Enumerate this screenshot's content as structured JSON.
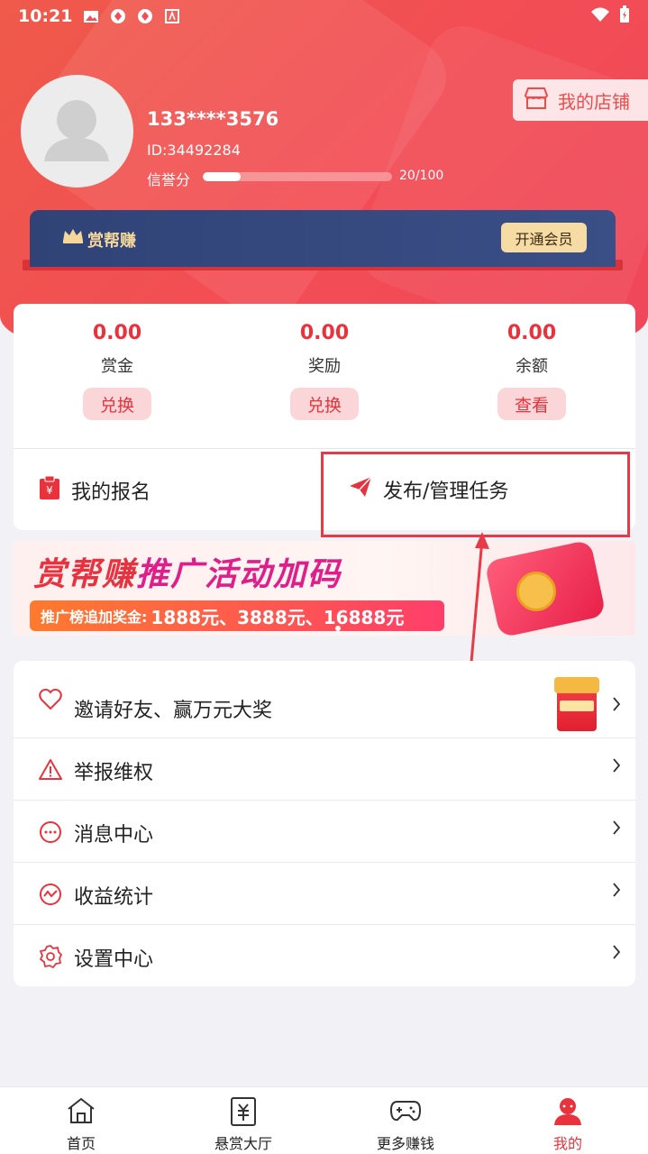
{
  "status_bar": {
    "time": "10:21"
  },
  "user": {
    "name": "133****3576",
    "id_text": "ID:34492284",
    "credit_label": "信誉分",
    "credit_value": "20/100",
    "credit_fraction": 0.2
  },
  "shop_button": {
    "label": "我的店铺"
  },
  "vip": {
    "title": "赏帮赚",
    "button": "开通会员"
  },
  "wallet": [
    {
      "amount": "0.00",
      "label": "赏金",
      "button": "兑换"
    },
    {
      "amount": "0.00",
      "label": "奖励",
      "button": "兑换"
    },
    {
      "amount": "0.00",
      "label": "余额",
      "button": "查看"
    }
  ],
  "actions": {
    "my_signup": "我的报名",
    "publish_task": "发布/管理任务"
  },
  "banner": {
    "title_a": "赏帮赚",
    "title_b": "推广活动加码",
    "strip_label": "推广榜追加奖金:",
    "strip_amounts": "1888元、3888元、16888元"
  },
  "menu": [
    {
      "label": "邀请好友、赢万元大奖",
      "icon": "heart-icon"
    },
    {
      "label": "举报维权",
      "icon": "warning-icon"
    },
    {
      "label": "消息中心",
      "icon": "message-icon"
    },
    {
      "label": "收益统计",
      "icon": "chart-icon"
    },
    {
      "label": "设置中心",
      "icon": "gear-icon"
    }
  ],
  "tabs": [
    {
      "label": "首页",
      "icon": "home-icon"
    },
    {
      "label": "悬赏大厅",
      "icon": "yuan-doc-icon"
    },
    {
      "label": "更多赚钱",
      "icon": "gamepad-icon"
    },
    {
      "label": "我的",
      "icon": "user-icon",
      "active": true
    }
  ],
  "colors": {
    "accent": "#e8333d",
    "header": "#f24d55",
    "vip_card": "#2f4377",
    "vip_gold": "#f7dba4"
  }
}
